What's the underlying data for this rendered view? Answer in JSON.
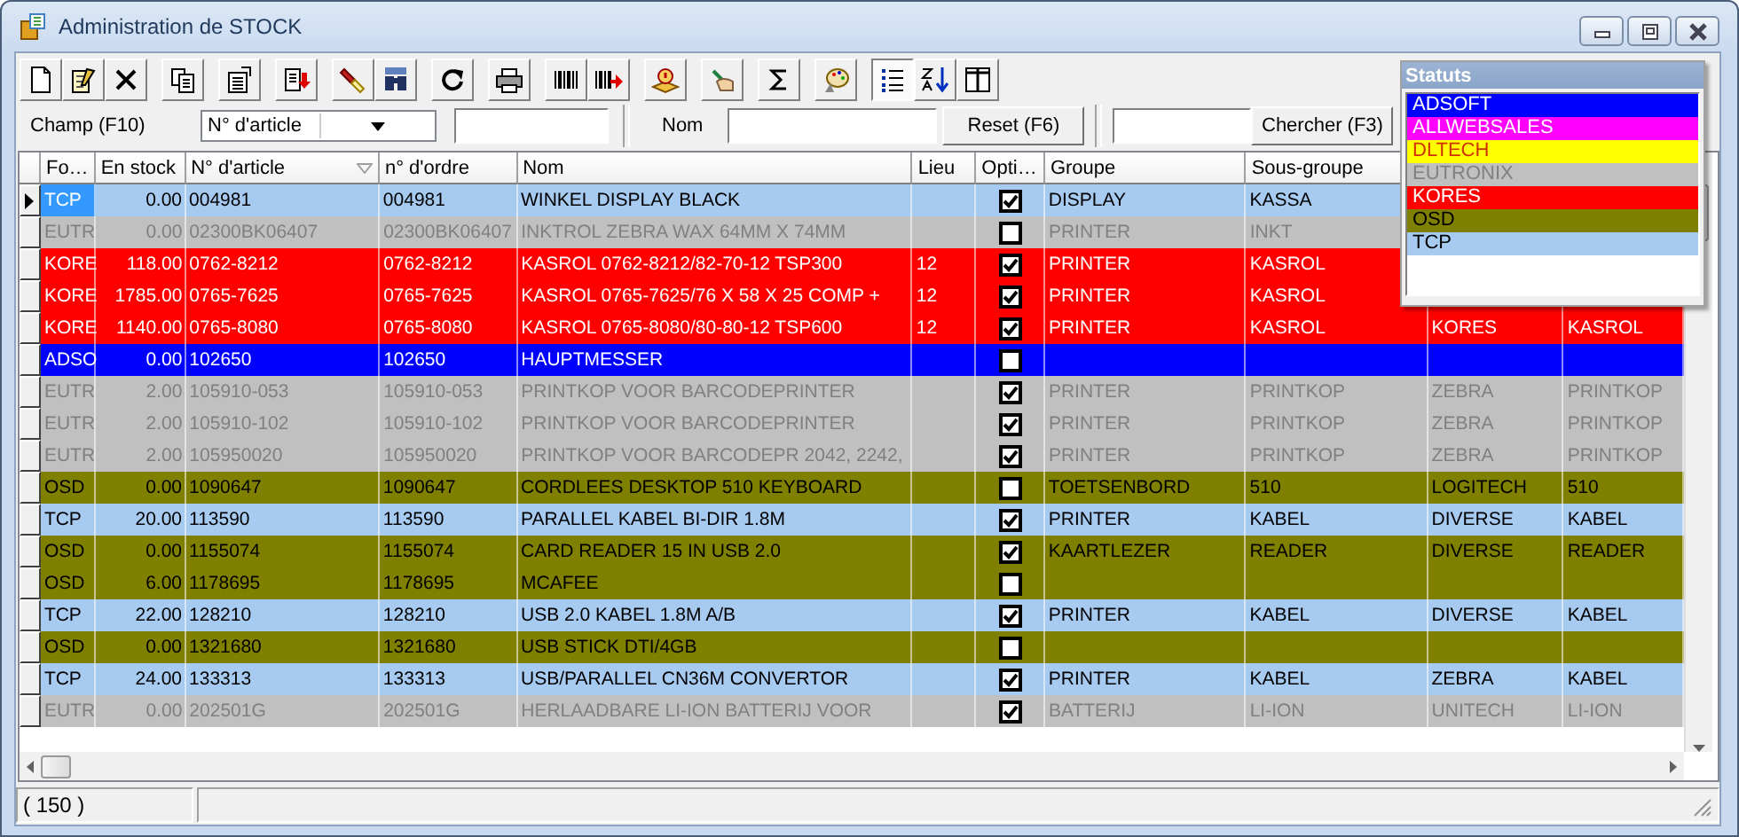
{
  "window": {
    "title": "Administration de STOCK"
  },
  "toolbar_groups": [
    [
      {
        "kind": "new",
        "pressed": false
      },
      {
        "kind": "edit",
        "pressed": false
      },
      {
        "kind": "delete",
        "pressed": false
      }
    ],
    [
      {
        "kind": "copy",
        "pressed": false
      }
    ],
    [
      {
        "kind": "properties",
        "pressed": false
      }
    ],
    [
      {
        "kind": "export",
        "pressed": false
      }
    ],
    [
      {
        "kind": "flashlight",
        "pressed": false
      },
      {
        "kind": "binoculars",
        "pressed": false
      }
    ],
    [
      {
        "kind": "refresh",
        "pressed": false
      }
    ],
    [
      {
        "kind": "print",
        "pressed": false
      }
    ],
    [
      {
        "kind": "barcode",
        "pressed": false
      },
      {
        "kind": "barcode_arrow",
        "pressed": false
      }
    ],
    [
      {
        "kind": "alert",
        "pressed": false
      }
    ],
    [
      {
        "kind": "hand",
        "pressed": false
      }
    ],
    [
      {
        "kind": "sigma",
        "pressed": false
      }
    ],
    [
      {
        "kind": "palette",
        "pressed": false
      }
    ],
    [
      {
        "kind": "list",
        "pressed": true
      },
      {
        "kind": "sort",
        "pressed": false
      },
      {
        "kind": "columns",
        "pressed": false
      }
    ]
  ],
  "filter": {
    "field_label": "Champ (F10)",
    "field_value": "N° d'article",
    "name_label": "Nom",
    "reset_button": "Reset (F6)",
    "search_button": "Chercher (F3)"
  },
  "table": {
    "columns": [
      {
        "label": "Fo…",
        "sorted": false
      },
      {
        "label": "En stock",
        "sorted": false
      },
      {
        "label": "N° d'article",
        "sorted": true
      },
      {
        "label": "n° d'ordre",
        "sorted": false
      },
      {
        "label": "Nom",
        "sorted": false
      },
      {
        "label": "Lieu",
        "sorted": false
      },
      {
        "label": "Opti…",
        "sorted": false
      },
      {
        "label": "Groupe",
        "sorted": false
      },
      {
        "label": "Sous-groupe",
        "sorted": false
      }
    ],
    "rows": [
      {
        "selected": true,
        "color": "#a6caf0",
        "kind": "normal",
        "checked": true,
        "cells": [
          "TCP",
          "0.00",
          "004981",
          "004981",
          "WINKEL DISPLAY BLACK",
          null,
          null,
          "DISPLAY",
          "KASSA"
        ]
      },
      {
        "selected": false,
        "color": "#c0c0c0",
        "kind": "dimmed",
        "checked": false,
        "cells": [
          "EUTR",
          "0.00",
          "02300BK06407",
          "02300BK06407",
          "INKTROL ZEBRA WAX 64MM X 74MM",
          null,
          null,
          "PRINTER",
          "INKT"
        ]
      },
      {
        "selected": false,
        "color": "#ff0000",
        "kind": "inverted",
        "checked": true,
        "cells": [
          "KORE",
          "118.00",
          "0762-8212",
          "0762-8212",
          "KASROL 0762-8212/82-70-12 TSP300",
          "12",
          null,
          "PRINTER",
          "KASROL"
        ]
      },
      {
        "selected": false,
        "color": "#ff0000",
        "kind": "inverted",
        "checked": true,
        "cells": [
          "KORE",
          "1785.00",
          "0765-7625",
          "0765-7625",
          "KASROL 0765-7625/76 X 58 X 25 COMP +",
          "12",
          null,
          "PRINTER",
          "KASROL"
        ]
      },
      {
        "selected": false,
        "color": "#ff0000",
        "kind": "inverted",
        "checked": true,
        "cells": [
          "KORE",
          "1140.00",
          "0765-8080",
          "0765-8080",
          "KASROL 0765-8080/80-80-12 TSP600",
          "12",
          null,
          "PRINTER",
          "KASROL",
          "KORES",
          "KASROL"
        ]
      },
      {
        "selected": false,
        "color": "#0000ff",
        "kind": "inverted",
        "checked": false,
        "cells": [
          "ADSO",
          "0.00",
          "102650",
          "102650",
          "HAUPTMESSER"
        ]
      },
      {
        "selected": false,
        "color": "#c0c0c0",
        "kind": "dimmed",
        "checked": true,
        "cells": [
          "EUTR",
          "2.00",
          "105910-053",
          "105910-053",
          "PRINTKOP VOOR BARCODEPRINTER",
          null,
          null,
          "PRINTER",
          "PRINTKOP",
          "ZEBRA",
          "PRINTKOP"
        ]
      },
      {
        "selected": false,
        "color": "#c0c0c0",
        "kind": "dimmed",
        "checked": true,
        "cells": [
          "EUTR",
          "2.00",
          "105910-102",
          "105910-102",
          "PRINTKOP VOOR BARCODEPRINTER",
          null,
          null,
          "PRINTER",
          "PRINTKOP",
          "ZEBRA",
          "PRINTKOP"
        ]
      },
      {
        "selected": false,
        "color": "#c0c0c0",
        "kind": "dimmed",
        "checked": true,
        "cells": [
          "EUTR",
          "2.00",
          "105950020",
          "105950020",
          "PRINTKOP VOOR BARCODEPR 2042, 2242,",
          null,
          null,
          "PRINTER",
          "PRINTKOP",
          "ZEBRA",
          "PRINTKOP"
        ]
      },
      {
        "selected": false,
        "color": "#808000",
        "kind": "normal",
        "checked": false,
        "cells": [
          "OSD",
          "0.00",
          "1090647",
          "1090647",
          "CORDLEES DESKTOP 510 KEYBOARD",
          null,
          null,
          "TOETSENBORD",
          "510",
          "LOGITECH",
          "510"
        ]
      },
      {
        "selected": false,
        "color": "#a6caf0",
        "kind": "normal",
        "checked": true,
        "cells": [
          "TCP",
          "20.00",
          "113590",
          "113590",
          "PARALLEL KABEL BI-DIR 1.8M",
          null,
          null,
          "PRINTER",
          "KABEL",
          "DIVERSE",
          "KABEL"
        ]
      },
      {
        "selected": false,
        "color": "#808000",
        "kind": "normal",
        "checked": true,
        "cells": [
          "OSD",
          "0.00",
          "1155074",
          "1155074",
          "CARD READER 15 IN USB 2.0",
          null,
          null,
          "KAARTLEZER",
          "READER",
          "DIVERSE",
          "READER"
        ]
      },
      {
        "selected": false,
        "color": "#808000",
        "kind": "normal",
        "checked": false,
        "cells": [
          "OSD",
          "6.00",
          "1178695",
          "1178695",
          "MCAFEE"
        ]
      },
      {
        "selected": false,
        "color": "#a6caf0",
        "kind": "normal",
        "checked": true,
        "cells": [
          "TCP",
          "22.00",
          "128210",
          "128210",
          "USB 2.0 KABEL 1.8M A/B",
          null,
          null,
          "PRINTER",
          "KABEL",
          "DIVERSE",
          "KABEL"
        ]
      },
      {
        "selected": false,
        "color": "#808000",
        "kind": "normal",
        "checked": false,
        "cells": [
          "OSD",
          "0.00",
          "1321680",
          "1321680",
          "USB STICK DTI/4GB"
        ]
      },
      {
        "selected": false,
        "color": "#a6caf0",
        "kind": "normal",
        "checked": true,
        "cells": [
          "TCP",
          "24.00",
          "133313",
          "133313",
          "USB/PARALLEL CN36M CONVERTOR",
          null,
          null,
          "PRINTER",
          "KABEL",
          "ZEBRA",
          "KABEL"
        ]
      },
      {
        "selected": false,
        "color": "#c0c0c0",
        "kind": "dimmed",
        "checked": true,
        "cells": [
          "EUTR",
          "0.00",
          "202501G",
          "202501G",
          "HERLAADBARE LI-ION BATTERIJ VOOR",
          null,
          null,
          "BATTERIJ",
          "LI-ION",
          "UNITECH",
          "LI-ION"
        ]
      }
    ]
  },
  "legend": {
    "title": "Statuts",
    "items": [
      {
        "label": "ADSOFT",
        "color": "#0000ff",
        "kind": "inverted"
      },
      {
        "label": "ALLWEBSALES",
        "color": "#ff00ff",
        "kind": "inverted"
      },
      {
        "label": "DLTECH",
        "color": "#ffff00",
        "kind": "accent"
      },
      {
        "label": "EUTRONIX",
        "color": "#c0c0c0",
        "kind": "dimmed"
      },
      {
        "label": "KORES",
        "color": "#ff0000",
        "kind": "inverted"
      },
      {
        "label": "OSD",
        "color": "#808000",
        "kind": "normal"
      },
      {
        "label": "TCP",
        "color": "#a6caf0",
        "kind": "normal"
      }
    ]
  },
  "status_bar": {
    "count": "( 150 )"
  }
}
